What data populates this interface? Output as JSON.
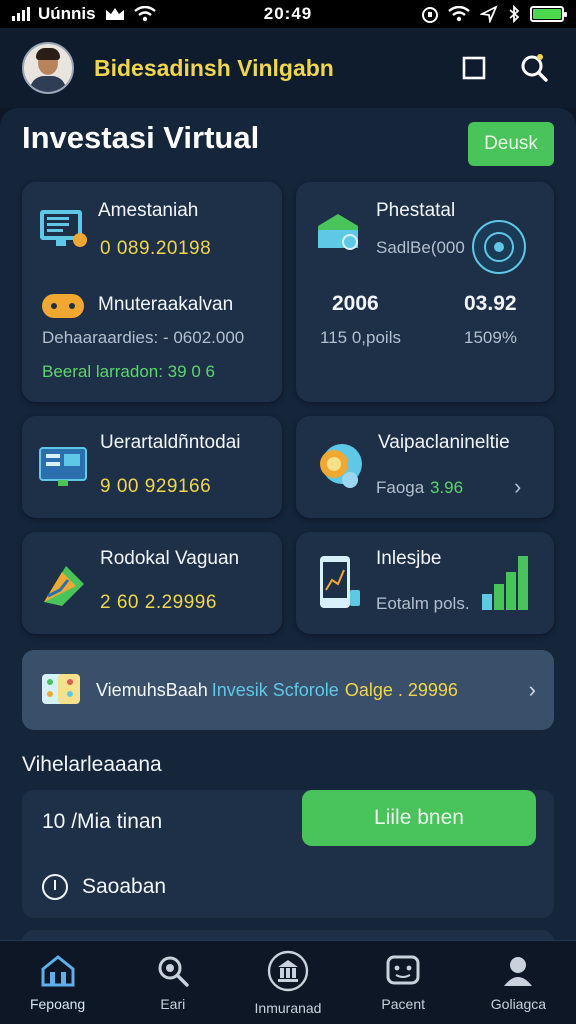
{
  "status_bar": {
    "carrier": "Uúnnis",
    "time": "20:49"
  },
  "header": {
    "title": "Bidesadinsh Vinlgabn",
    "icons": [
      "avatar",
      "square-icon",
      "search-icon"
    ]
  },
  "page": {
    "title": "Investasi Virtual",
    "top_button": "Deusk"
  },
  "cards": {
    "left_top": {
      "title1": "Amestaniah",
      "value1": "0 089.20198",
      "title2": "Mnuteraakalvan",
      "detail": "Dehaaraardies: - 0602.000",
      "green": "Beeral larradon: 39 0 6"
    },
    "right_top": {
      "title": "Phestatal",
      "subtitle": "SadlBe(000",
      "stat1_value": "2006",
      "stat1_label": "115 0,poils",
      "stat2_value": "03.92",
      "stat2_label": "1509%"
    },
    "mid_left": {
      "title": "Uerartaldñntodai",
      "value": "9 00 929166"
    },
    "mid_right": {
      "title": "Vaipaclanineltie",
      "label": "Faoga",
      "value": "3.96"
    },
    "low_left": {
      "title": "Rodokal Vaguan",
      "value": "2 60 2.29996"
    },
    "low_right": {
      "title": "Inlesjbe",
      "label": "Eotalm pols."
    }
  },
  "banner": {
    "part1": "ViemuhsBaah",
    "part2": "Invesik Scforole",
    "part3": "Oalge . 29996"
  },
  "section": {
    "label": "Vihelarleaaana"
  },
  "bottom_card": {
    "text1": "10 /Mia tinan",
    "button": "Liile bnen",
    "row2": "Saoaban"
  },
  "tabs": [
    {
      "label": "Fepoang",
      "icon": "home-icon"
    },
    {
      "label": "Eari",
      "icon": "search-icon"
    },
    {
      "label": "Inmuranad",
      "icon": "bank-icon"
    },
    {
      "label": "Pacent",
      "icon": "chat-icon"
    },
    {
      "label": "Goliagca",
      "icon": "profile-icon"
    }
  ],
  "colors": {
    "background": "#0d1726",
    "card": "#1e3048",
    "accent_yellow": "#f0d64a",
    "accent_green": "#48c45b",
    "accent_cyan": "#5fc8e6"
  }
}
